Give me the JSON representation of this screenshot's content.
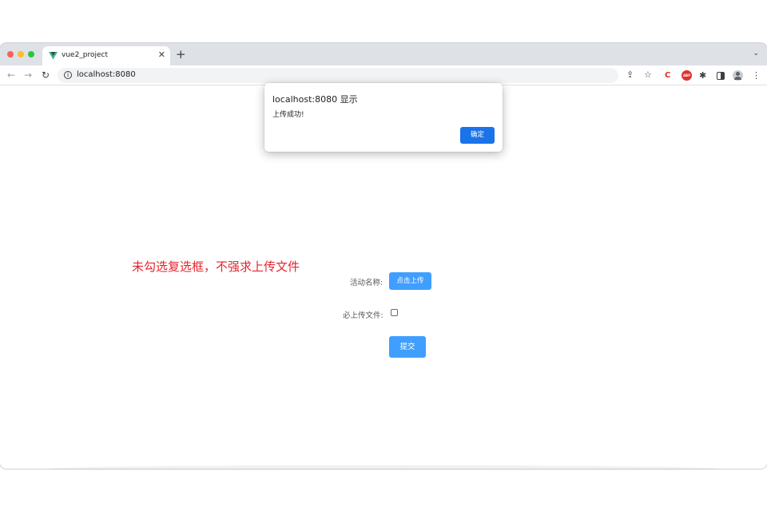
{
  "browser": {
    "tab_title": "vue2_project",
    "tab_close": "✕",
    "new_tab": "+",
    "tab_menu": "⌄",
    "url": "localhost:8080",
    "icons": {
      "back": "arrow-left-icon",
      "forward": "arrow-right-icon",
      "reload": "reload-icon",
      "info": "info-icon",
      "share": "share-icon",
      "star": "star-icon",
      "extensions": "puzzle-icon",
      "side_panel": "side-panel-icon",
      "profile": "avatar-icon",
      "more": "more-vert-icon"
    },
    "ext_abp": "ABP",
    "ext_c": "C"
  },
  "dialog": {
    "title": "localhost:8080 显示",
    "message": "上传成功!",
    "ok_label": "确定"
  },
  "page": {
    "annotation": "未勾选复选框，不强求上传文件",
    "activity_label": "活动名称:",
    "upload_button": "点击上传",
    "required_label": "必上传文件:",
    "required_checked": false,
    "submit_button": "提交"
  },
  "colors": {
    "primary_button": "#409eff",
    "dialog_button": "#1a73e8",
    "annotation": "#e3262e"
  }
}
